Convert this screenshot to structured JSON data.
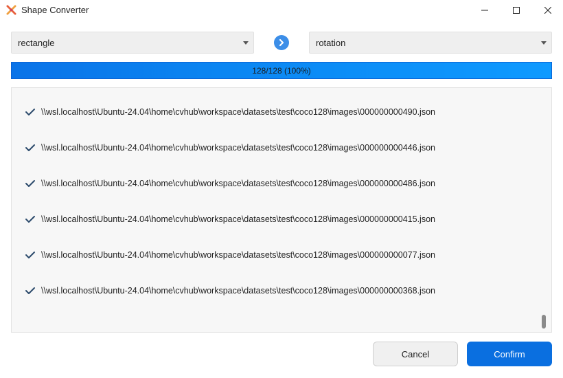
{
  "window": {
    "title": "Shape Converter"
  },
  "converter": {
    "from_value": "rectangle",
    "to_value": "rotation"
  },
  "progress": {
    "label": "128/128 (100%)",
    "fraction": 1.0
  },
  "results": [
    {
      "status": "success",
      "path": "\\\\wsl.localhost\\Ubuntu-24.04\\home\\cvhub\\workspace\\datasets\\test\\coco128\\images\\000000000490.json"
    },
    {
      "status": "success",
      "path": "\\\\wsl.localhost\\Ubuntu-24.04\\home\\cvhub\\workspace\\datasets\\test\\coco128\\images\\000000000446.json"
    },
    {
      "status": "success",
      "path": "\\\\wsl.localhost\\Ubuntu-24.04\\home\\cvhub\\workspace\\datasets\\test\\coco128\\images\\000000000486.json"
    },
    {
      "status": "success",
      "path": "\\\\wsl.localhost\\Ubuntu-24.04\\home\\cvhub\\workspace\\datasets\\test\\coco128\\images\\000000000415.json"
    },
    {
      "status": "success",
      "path": "\\\\wsl.localhost\\Ubuntu-24.04\\home\\cvhub\\workspace\\datasets\\test\\coco128\\images\\000000000077.json"
    },
    {
      "status": "success",
      "path": "\\\\wsl.localhost\\Ubuntu-24.04\\home\\cvhub\\workspace\\datasets\\test\\coco128\\images\\000000000368.json"
    }
  ],
  "actions": {
    "cancel_label": "Cancel",
    "confirm_label": "Confirm"
  },
  "colors": {
    "accent": "#0a6fe0",
    "progress": "#0b86f2",
    "arrow": "#3c8ee8"
  },
  "icons": {
    "app": "shape-converter-logo-icon",
    "convert": "chevron-right-icon",
    "status": "checkmark-icon"
  }
}
